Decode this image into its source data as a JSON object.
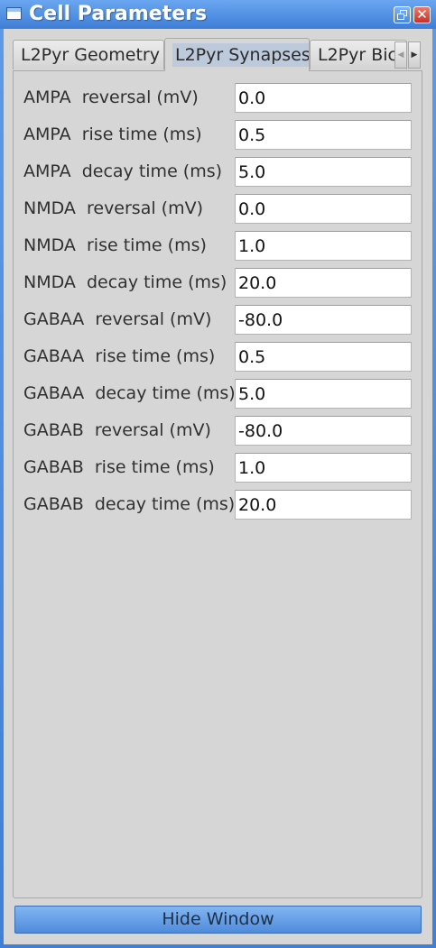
{
  "window": {
    "title": "Cell Parameters",
    "restore_icon": "restore-icon",
    "close_glyph": "✕"
  },
  "tabs": {
    "items": [
      {
        "label": "L2Pyr Geometry"
      },
      {
        "label": "L2Pyr Synapses"
      },
      {
        "label": "L2Pyr Bic"
      }
    ],
    "active": "L2Pyr Synapses",
    "scroll_left_glyph": "◀",
    "scroll_right_glyph": "▶"
  },
  "params": [
    {
      "label": "AMPA  reversal (mV)",
      "value": "0.0"
    },
    {
      "label": "AMPA  rise time (ms)",
      "value": "0.5"
    },
    {
      "label": "AMPA  decay time (ms)",
      "value": "5.0"
    },
    {
      "label": "NMDA  reversal (mV)",
      "value": "0.0"
    },
    {
      "label": "NMDA  rise time (ms)",
      "value": "1.0"
    },
    {
      "label": "NMDA  decay time (ms)",
      "value": "20.0"
    },
    {
      "label": "GABAA  reversal (mV)",
      "value": "-80.0"
    },
    {
      "label": "GABAA  rise time (ms)",
      "value": "0.5"
    },
    {
      "label": "GABAA  decay time (ms)",
      "value": "5.0"
    },
    {
      "label": "GABAB  reversal (mV)",
      "value": "-80.0"
    },
    {
      "label": "GABAB  rise time (ms)",
      "value": "1.0"
    },
    {
      "label": "GABAB  decay time (ms)",
      "value": "20.0"
    }
  ],
  "footer": {
    "hide_button_label": "Hide Window"
  },
  "colors": {
    "titlebar": "#4a88dc",
    "client_bg": "#d6d6d6",
    "active_tab_highlight": "#bccadb",
    "button_bg": "#6aa2e8"
  }
}
